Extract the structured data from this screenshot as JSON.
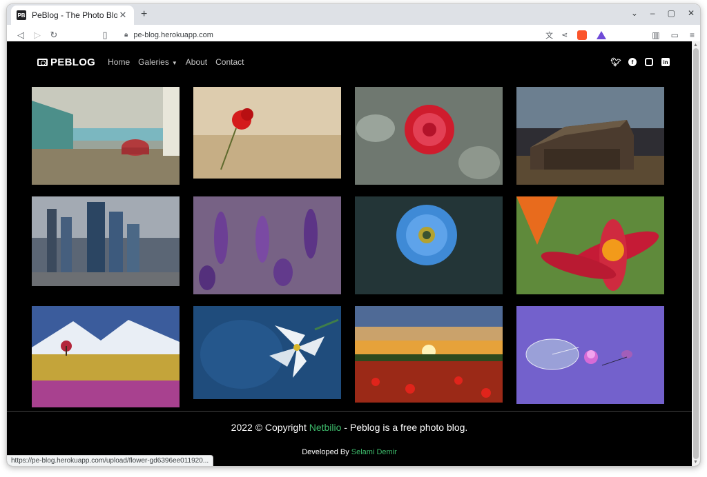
{
  "browser": {
    "tab_title": "PeBlog - The Photo Blog",
    "favicon_text": "PB",
    "url": "pe-blog.herokuapp.com",
    "status_url": "https://pe-blog.herokuapp.com/upload/flower-gd6396ee011920..."
  },
  "site": {
    "brand": "PEBLOG",
    "nav": [
      {
        "label": "Home"
      },
      {
        "label": "Galeries"
      },
      {
        "label": "About"
      },
      {
        "label": "Contact"
      }
    ],
    "social": [
      "twitter-icon",
      "facebook-icon",
      "instagram-icon",
      "linkedin-icon"
    ]
  },
  "gallery": [
    {
      "name": "photo-beetle-car"
    },
    {
      "name": "photo-red-poppy-wheat"
    },
    {
      "name": "photo-frozen-red-rose"
    },
    {
      "name": "photo-old-barn"
    },
    {
      "name": "photo-city-skyscrapers"
    },
    {
      "name": "photo-lavender"
    },
    {
      "name": "photo-blue-poppy"
    },
    {
      "name": "photo-red-lily"
    },
    {
      "name": "photo-snow-mountain-meadow"
    },
    {
      "name": "photo-white-lily-blue"
    },
    {
      "name": "photo-sunset-poppy-field"
    },
    {
      "name": "photo-lotus-lily-pad"
    }
  ],
  "footer": {
    "copyright_prefix": "2022 © Copyright ",
    "company": "Netbilio",
    "copyright_suffix": " - Peblog is a free photo blog.",
    "developed_prefix": "Developed By ",
    "developer": "Selami Demir"
  },
  "colors": {
    "accent_green": "#3dbb6b",
    "page_bg": "#000000"
  }
}
